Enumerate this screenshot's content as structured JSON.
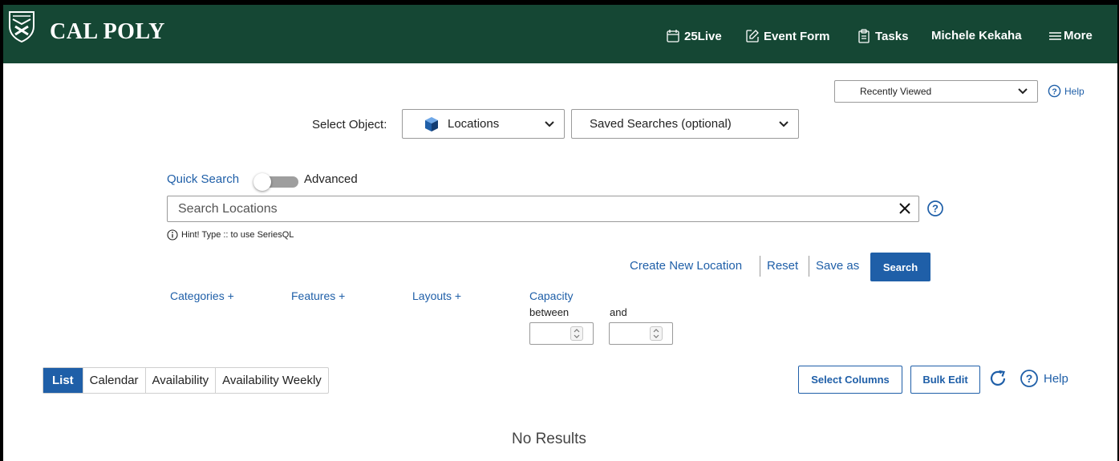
{
  "header": {
    "brand_main": "CAL",
    "brand_poly": "POLY",
    "nav": {
      "live": "25Live",
      "event_form": "Event Form",
      "tasks": "Tasks",
      "user": "Michele Kekaha",
      "more": "More"
    },
    "color": "#154734"
  },
  "recently_viewed": {
    "value": "Recently Viewed"
  },
  "top_help": "Help",
  "object_select": {
    "label": "Select Object:",
    "object": "Locations",
    "saved_searches": "Saved Searches (optional)"
  },
  "search": {
    "quick_label": "Quick Search",
    "advanced_label": "Advanced",
    "placeholder": "Search Locations",
    "hint": "Hint! Type :: to use SeriesQL"
  },
  "actions": {
    "create_new": "Create New Location",
    "reset": "Reset",
    "save_as": "Save as",
    "search": "Search"
  },
  "filters": {
    "categories": "Categories +",
    "features": "Features +",
    "layouts": "Layouts +",
    "capacity": "Capacity",
    "between": "between",
    "and": "and"
  },
  "tabs": [
    "List",
    "Calendar",
    "Availability",
    "Availability Weekly"
  ],
  "toolbar": {
    "select_columns": "Select Columns",
    "bulk_edit": "Bulk Edit",
    "help": "Help"
  },
  "results": {
    "empty": "No Results"
  },
  "accent_color": "#1f5fa8"
}
